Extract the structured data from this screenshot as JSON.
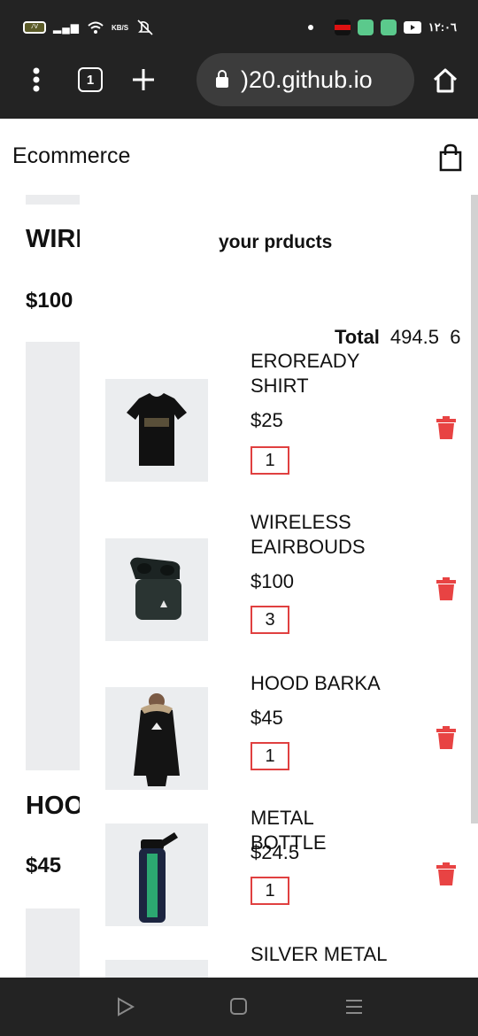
{
  "status_bar": {
    "battery": "ﾉV",
    "speed": "KB/S",
    "clock": "١٢:٠٦",
    "icons": [
      "battery-icon",
      "signal-icon",
      "wifi-icon",
      "mute-icon",
      "dot-icon",
      "flag-icon",
      "phone-icon",
      "android-icon",
      "youtube-icon"
    ]
  },
  "browser": {
    "url": ")20.github.io",
    "tab_count": "1",
    "icons": [
      "menu-dots-icon",
      "tabs-icon",
      "plus-icon",
      "lock-icon",
      "home-icon"
    ]
  },
  "app": {
    "title": "Ecommerce",
    "cart_icon": "shopping-bag-icon"
  },
  "background_products": [
    {
      "name": "WIRI",
      "price": "$100"
    },
    {
      "name": "HOO",
      "price": "$45"
    }
  ],
  "cart": {
    "title": "your prducts",
    "total_label": "Total",
    "total_value": "494.5",
    "total_count": "6",
    "accent_color": "#e84343",
    "items": [
      {
        "name": "EROREADY SHIRT",
        "price": "$25",
        "qty": "1",
        "image": "black-tshirt"
      },
      {
        "name": "WIRELESS EAIRBOUDS",
        "price": "$100",
        "qty": "3",
        "image": "earbuds-case"
      },
      {
        "name": "HOOD BARKA",
        "price": "$45",
        "qty": "1",
        "image": "hooded-jacket"
      },
      {
        "name": "METAL BOTTLE",
        "price": "$24.5",
        "qty": "1",
        "image": "water-bottle"
      },
      {
        "name": "SILVER METAL",
        "price": "",
        "qty": "",
        "image": "silver-product"
      }
    ]
  },
  "nav_bar": {
    "icons": [
      "back-triangle-icon",
      "home-square-icon",
      "recents-lines-icon"
    ]
  }
}
